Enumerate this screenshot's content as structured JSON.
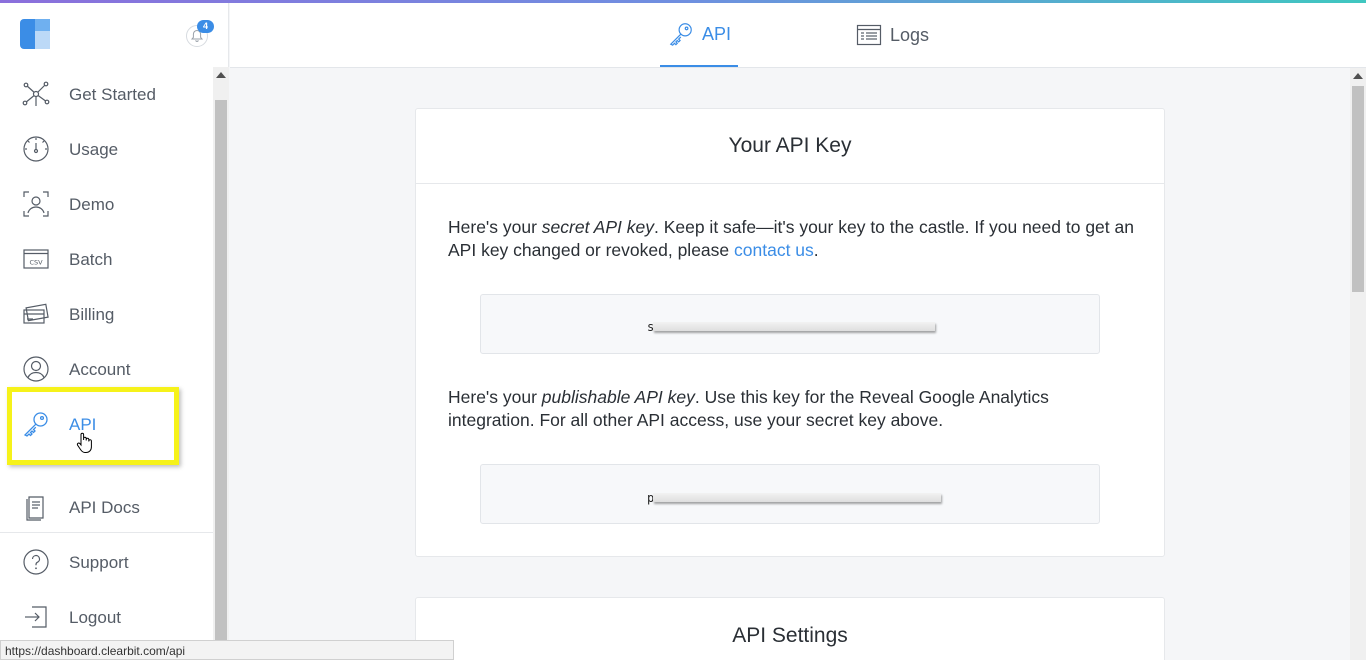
{
  "notifications": {
    "count": "4"
  },
  "sidebar": {
    "items": [
      {
        "label": "Get Started",
        "icon": "network-icon"
      },
      {
        "label": "Usage",
        "icon": "gauge-icon"
      },
      {
        "label": "Demo",
        "icon": "user-scan-icon"
      },
      {
        "label": "Batch",
        "icon": "csv-icon"
      },
      {
        "label": "Billing",
        "icon": "credit-card-icon"
      },
      {
        "label": "Account",
        "icon": "user-circle-icon"
      },
      {
        "label": "API",
        "icon": "key-icon",
        "active": true
      }
    ],
    "secondary": [
      {
        "label": "API Docs",
        "icon": "document-icon"
      },
      {
        "label": "Support",
        "icon": "question-icon"
      },
      {
        "label": "Logout",
        "icon": "logout-icon"
      }
    ]
  },
  "tabs": [
    {
      "label": "API",
      "active": true
    },
    {
      "label": "Logs",
      "active": false
    }
  ],
  "api_key_card": {
    "title": "Your API Key",
    "secret_text_1": "Here's your ",
    "secret_em": "secret API key",
    "secret_text_2": ". Keep it safe—it's your key to the castle. If you need to get an API key changed or revoked, please ",
    "contact_link": "contact us",
    "secret_text_3": ".",
    "secret_key_prefix": "s",
    "publishable_text_1": "Here's your ",
    "publishable_em": "publishable API key",
    "publishable_text_2": ". Use this key for the Reveal Google Analytics integration. For all other API access, use your secret key above.",
    "publishable_key_prefix": "p"
  },
  "api_settings_card": {
    "title": "API Settings"
  },
  "status_bar": {
    "url": "https://dashboard.clearbit.com/api"
  },
  "colors": {
    "accent": "#3b8de6",
    "highlight": "#f6f21a"
  }
}
